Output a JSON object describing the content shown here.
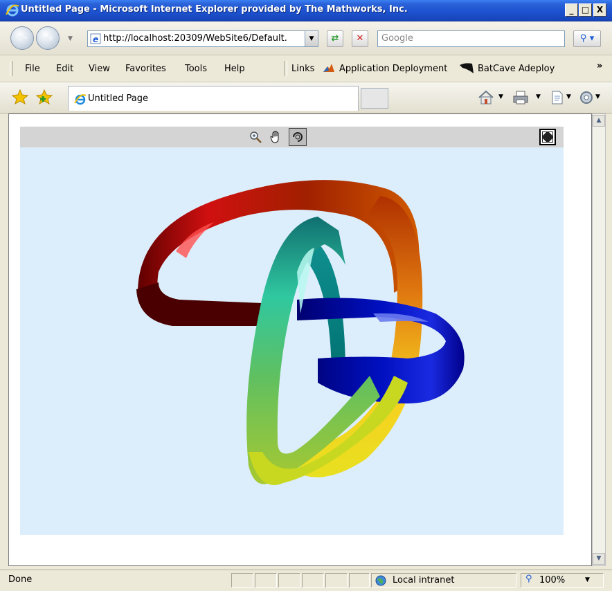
{
  "window": {
    "title": "Untitled Page - Microsoft Internet Explorer provided by The Mathworks, Inc.",
    "minimize": "_",
    "maximize": "□",
    "close": "X"
  },
  "address_bar": {
    "url": "http://localhost:20309/WebSite6/Default.",
    "search_placeholder": "Google"
  },
  "menu": {
    "items": [
      "File",
      "Edit",
      "View",
      "Favorites",
      "Tools",
      "Help"
    ],
    "links_label": "Links",
    "link_items": [
      "Application Deployment",
      "BatCave Adeploy"
    ],
    "more": "»"
  },
  "tab": {
    "title": "Untitled Page"
  },
  "status": {
    "text": "Done",
    "zone": "Local intranet",
    "zoom": "100%"
  },
  "colors": {
    "title_bar": "#2a62d8",
    "chrome": "#ece9d8",
    "figure_bg": "#dceefb",
    "figure_toolbar": "#d4d4d4"
  },
  "icons": [
    "zoom-in-icon",
    "pan-hand-icon",
    "rotate-3d-icon",
    "fullscreen-icon",
    "home-icon",
    "print-icon",
    "page-icon",
    "tools-icon",
    "favorites-star-icon",
    "add-favorite-icon"
  ]
}
